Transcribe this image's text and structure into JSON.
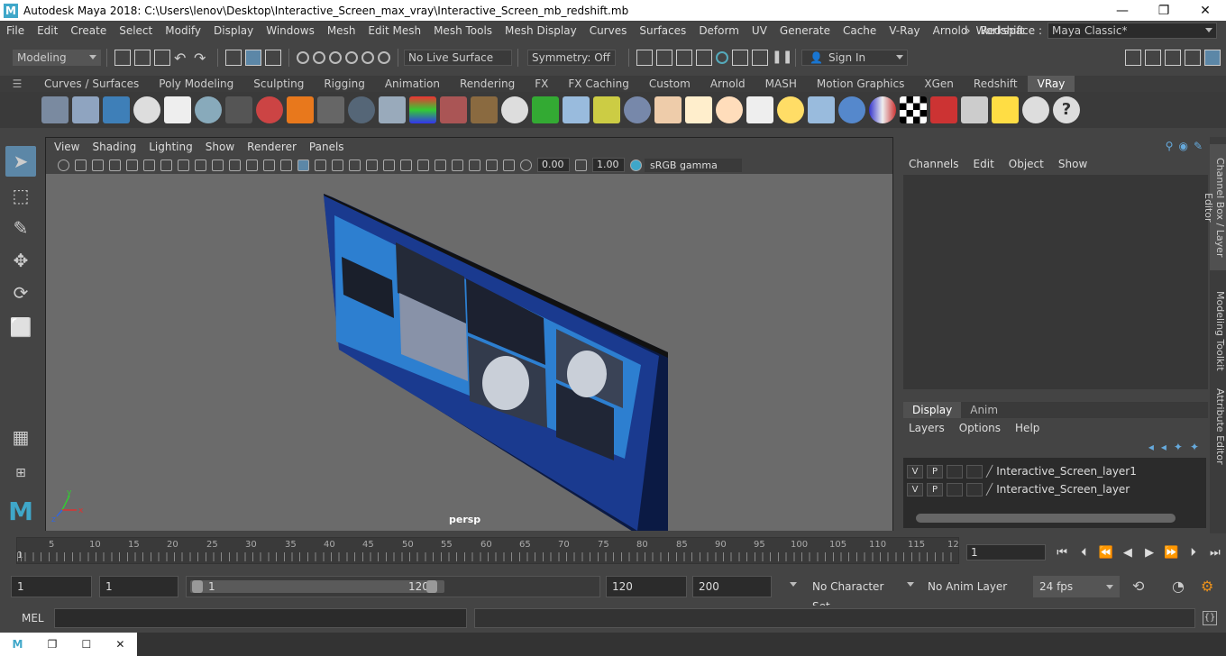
{
  "window": {
    "title": "Autodesk Maya 2018: C:\\Users\\lenov\\Desktop\\Interactive_Screen_max_vray\\Interactive_Screen_mb_redshift.mb",
    "logo": "M",
    "minimize": "—",
    "maximize": "❐",
    "close": "✕"
  },
  "menubar": {
    "items": [
      "File",
      "Edit",
      "Create",
      "Select",
      "Modify",
      "Display",
      "Windows",
      "Mesh",
      "Edit Mesh",
      "Mesh Tools",
      "Mesh Display",
      "Curves",
      "Surfaces",
      "Deform",
      "UV",
      "Generate",
      "Cache",
      "V-Ray",
      "Arnold",
      "Redshift"
    ],
    "more": "»",
    "workspace_label": "Workspace :",
    "workspace_value": "Maya Classic*"
  },
  "statusline": {
    "mode": "Modeling",
    "live_surface": "No Live Surface",
    "symmetry": "Symmetry: Off",
    "sign_in": "Sign In"
  },
  "shelf": {
    "tabs": [
      "Curves / Surfaces",
      "Poly Modeling",
      "Sculpting",
      "Rigging",
      "Animation",
      "Rendering",
      "FX",
      "FX Caching",
      "Custom",
      "Arnold",
      "MASH",
      "Motion Graphics",
      "XGen",
      "Redshift",
      "VRay"
    ],
    "active_tab": "VRay"
  },
  "viewport": {
    "menu": [
      "View",
      "Shading",
      "Lighting",
      "Show",
      "Renderer",
      "Panels"
    ],
    "exposure": "0.00",
    "gamma": "1.00",
    "color_space": "sRGB gamma",
    "camera": "persp",
    "axis_x": "x",
    "axis_y": "y",
    "axis_z": "z"
  },
  "channel_box": {
    "menu": [
      "Channels",
      "Edit",
      "Object",
      "Show"
    ],
    "tabs": [
      "Display",
      "Anim"
    ],
    "active_tab": "Display",
    "layer_menu": [
      "Layers",
      "Options",
      "Help"
    ],
    "layers": [
      {
        "v": "V",
        "p": "P",
        "name": "Interactive_Screen_layer1"
      },
      {
        "v": "V",
        "p": "P",
        "name": "Interactive_Screen_layer"
      }
    ]
  },
  "side_tabs": [
    "Channel Box / Layer Editor",
    "Modeling Toolkit",
    "Attribute Editor"
  ],
  "timeslider": {
    "ticks": [
      "5",
      "10",
      "15",
      "20",
      "25",
      "30",
      "35",
      "40",
      "45",
      "50",
      "55",
      "60",
      "65",
      "70",
      "75",
      "80",
      "85",
      "90",
      "95",
      "100",
      "105",
      "110",
      "115",
      "12"
    ],
    "start_marker": "1",
    "current_frame": "1"
  },
  "range": {
    "start": "1",
    "playback_start": "1",
    "slider_start": "1",
    "slider_end": "120",
    "playback_end": "120",
    "end": "200",
    "character_set": "No Character Set",
    "anim_layer": "No Anim Layer",
    "fps": "24 fps"
  },
  "cmdline": {
    "label": "MEL"
  }
}
